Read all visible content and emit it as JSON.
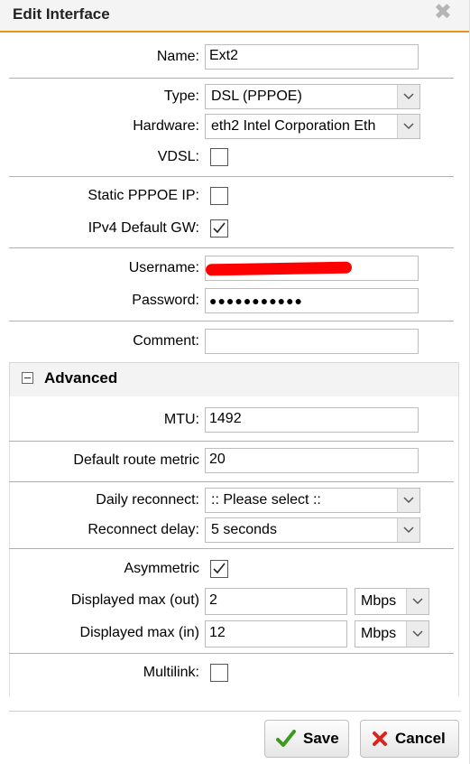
{
  "dialog": {
    "title": "Edit Interface"
  },
  "fields": {
    "name": {
      "label": "Name:",
      "value": "Ext2"
    },
    "type": {
      "label": "Type:",
      "value": "DSL (PPPOE)"
    },
    "hardware": {
      "label": "Hardware:",
      "value": "eth2 Intel Corporation Eth"
    },
    "vdsl": {
      "label": "VDSL:",
      "checked": false
    },
    "static_pppoe_ip": {
      "label": "Static PPPOE IP:",
      "checked": false
    },
    "ipv4_default_gw": {
      "label": "IPv4 Default GW:",
      "checked": true
    },
    "username": {
      "label": "Username:",
      "value": "",
      "redacted": true
    },
    "password": {
      "label": "Password:",
      "value": "●●●●●●●●●●●"
    },
    "comment": {
      "label": "Comment:",
      "value": ""
    }
  },
  "advanced": {
    "title": "Advanced",
    "mtu": {
      "label": "MTU:",
      "value": "1492"
    },
    "default_route_metric": {
      "label": "Default route metric",
      "value": "20"
    },
    "daily_reconnect": {
      "label": "Daily reconnect:",
      "value": ":: Please select ::"
    },
    "reconnect_delay": {
      "label": "Reconnect delay:",
      "value": "5 seconds"
    },
    "asymmetric": {
      "label": "Asymmetric",
      "checked": true
    },
    "max_out": {
      "label": "Displayed max (out)",
      "value": "2",
      "unit": "Mbps"
    },
    "max_in": {
      "label": "Displayed max (in)",
      "value": "12",
      "unit": "Mbps"
    },
    "multilink": {
      "label": "Multilink:",
      "checked": false
    }
  },
  "buttons": {
    "save": "Save",
    "cancel": "Cancel"
  },
  "colors": {
    "accent": "#e8941a",
    "save_check": "#3d9a1f",
    "cancel_x": "#d9261c",
    "redaction": "#ff0000"
  }
}
